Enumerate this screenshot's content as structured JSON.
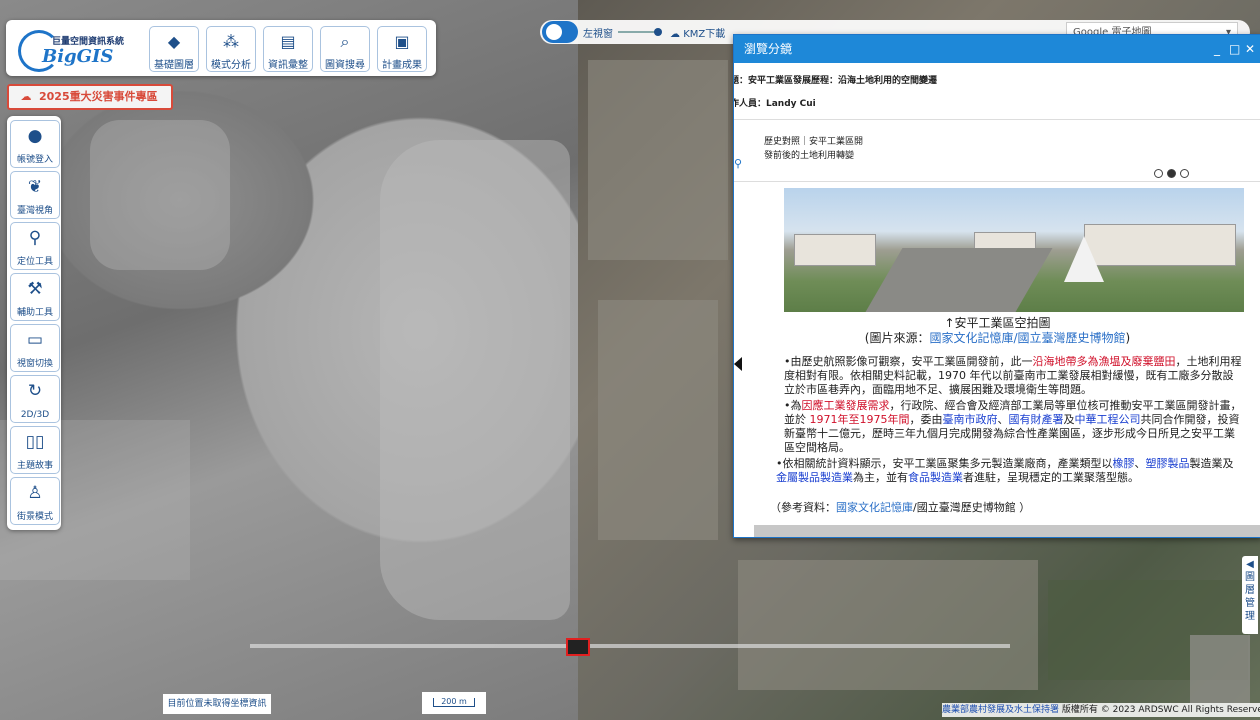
{
  "logo": {
    "name_cn": "巨量空間資訊系統",
    "name_en": "BigGIS"
  },
  "top_buttons": [
    {
      "icon": "layers-icon",
      "label": "基礎圖層"
    },
    {
      "icon": "analysis-icon",
      "label": "模式分析"
    },
    {
      "icon": "file-location-icon",
      "label": "資訊彙整"
    },
    {
      "icon": "search-icon",
      "label": "圖資搜尋"
    },
    {
      "icon": "image-icon",
      "label": "計畫成果"
    }
  ],
  "disaster_banner": "2025重大災害事件專區",
  "sidebar": [
    {
      "icon": "user-icon",
      "label": "帳號登入"
    },
    {
      "icon": "taiwan-icon",
      "label": "臺灣視角"
    },
    {
      "icon": "map-pin-icon",
      "label": "定位工具"
    },
    {
      "icon": "tools-icon",
      "label": "輔助工具"
    },
    {
      "icon": "window-icon",
      "label": "視窗切換"
    },
    {
      "icon": "3d-icon",
      "label": "2D/3D"
    },
    {
      "icon": "book-icon",
      "label": "主題故事"
    },
    {
      "icon": "street-view-icon",
      "label": "街景模式"
    }
  ],
  "toolbar": {
    "left_view": "左視窗",
    "kmz_download": "KMZ下載",
    "basemap": "Google 電子地圖"
  },
  "dialog": {
    "title": "瀏覽分鏡",
    "topic": "題：安平工業區發展歷程：沿海土地利用的空間變遷",
    "author": "作人員：Landy Cui",
    "story_label": "歷史對照｜安平工業區開發前後的土地利用轉變",
    "caption_line1": "↑安平工業區空拍圖",
    "caption_source_prefix": "(圖片來源：",
    "caption_source_link": "國家文化記憶庫/國立臺灣歷史博物館",
    "caption_source_suffix": ")",
    "p1_a": "•由歷史航照影像可觀察，安平工業區開發前，此一",
    "p1_red": "沿海地帶多為漁塭及廢棄鹽田",
    "p1_b": "，土地利用程度相對有限。依相關史料記載，1970 年代以前臺南市工業發展相對緩慢，既有工廠多分散設立於市區巷弄內，面臨用地不足、擴展困難及環境衛生等問題。",
    "p2_a": "•為",
    "p2_red1": "因應工業發展需求",
    "p2_b": "，行政院、經合會及經濟部工業局等單位核可推動安平工業區開發計畫，並於 ",
    "p2_red2": "1971年至1975年間",
    "p2_c": "，委由",
    "p2_blue1": "臺南市政府",
    "p2_d": "、",
    "p2_blue2": "國有財產署",
    "p2_e": "及",
    "p2_blue3": "中華工程公司",
    "p2_f": "共同合作開發，投資新臺幣十二億元，歷時三年九個月完成開發為綜合性產業園區，逐步形成今日所見之安平工業區空間格局。",
    "p3_a": "•依相關統計資料顯示，安平工業區聚集多元製造業廠商，產業類型以",
    "p3_blue1": "橡膠",
    "p3_b": "、",
    "p3_blue2": "塑膠製品",
    "p3_c": "製造業及",
    "p3_blue3": "金屬製品製造業",
    "p3_d": "為主，並有",
    "p3_blue4": "食品製造業",
    "p3_e": "者進駐，呈現穩定的工業聚落型態。",
    "ref_prefix": "（參考資料：",
    "ref_link": "國家文化記憶庫",
    "ref_suffix": "/國立臺灣歷史博物館 ）",
    "pager": {
      "current": 2,
      "total": 3
    }
  },
  "layer_manager": "◀圖層管理",
  "coord_text": "目前位置未取得坐標資訊",
  "scale_text": "200 m",
  "copyright": {
    "link": "農業部農村發展及水土保持署",
    "text": " 版權所有 © 2023 ARDSWC All Rights Reserved."
  },
  "colors": {
    "accent": "#1e88d8",
    "brand": "#1e74c8",
    "alert": "#d84a3a"
  }
}
